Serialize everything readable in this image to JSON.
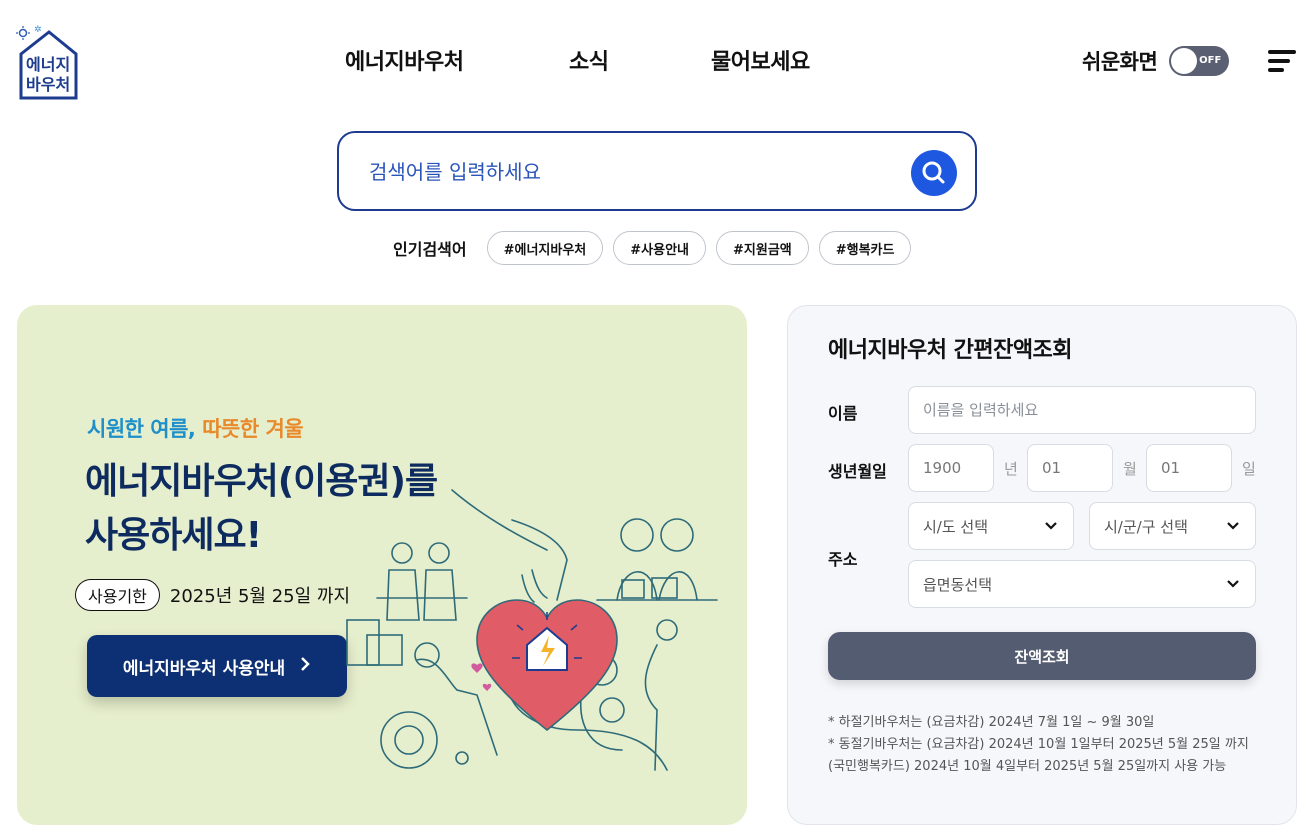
{
  "header": {
    "logo_text": [
      "에너지",
      "바우처"
    ],
    "nav": [
      "에너지바우처",
      "소식",
      "물어보세요"
    ],
    "easy_mode_label": "쉬운화면",
    "easy_mode_state": "OFF"
  },
  "search": {
    "placeholder": "검색어를 입력하세요",
    "popular_label": "인기검색어",
    "tags": [
      "#에너지바우처",
      "#사용안내",
      "#지원금액",
      "#행복카드"
    ]
  },
  "banner": {
    "subtitle_cool": "시원한 여름,",
    "subtitle_warm": "따뜻한 겨울",
    "title_line1": "에너지바우처(이용권)를",
    "title_line2": "사용하세요!",
    "deadline_label": "사용기한",
    "deadline_date": "2025년 5월 25일 까지",
    "button_label": "에너지바우처 사용안내",
    "colors": {
      "background": "#e6efcd",
      "cool": "#1e8fc9",
      "warm": "#e8892a",
      "title": "#0d2b5e",
      "button": "#0d2f74"
    }
  },
  "balance": {
    "title": "에너지바우처 간편잔액조회",
    "name_label": "이름",
    "name_placeholder": "이름을 입력하세요",
    "birth_label": "생년월일",
    "birth_year": "1900",
    "birth_year_unit": "년",
    "birth_month": "01",
    "birth_month_unit": "월",
    "birth_day": "01",
    "birth_day_unit": "일",
    "address_label": "주소",
    "sido": "시/도 선택",
    "sigungu": "시/군/구 선택",
    "eupmyeondong": "읍면동선택",
    "submit": "잔액조회",
    "notes": [
      "* 하절기바우처는 (요금차감) 2024년 7월 1일 ~ 9월 30일",
      "* 동절기바우처는 (요금차감) 2024년 10월 1일부터 2025년 5월 25일 까지 (국민행복카드) 2024년 10월 4일부터 2025년 5월 25일까지 사용 가능"
    ]
  }
}
